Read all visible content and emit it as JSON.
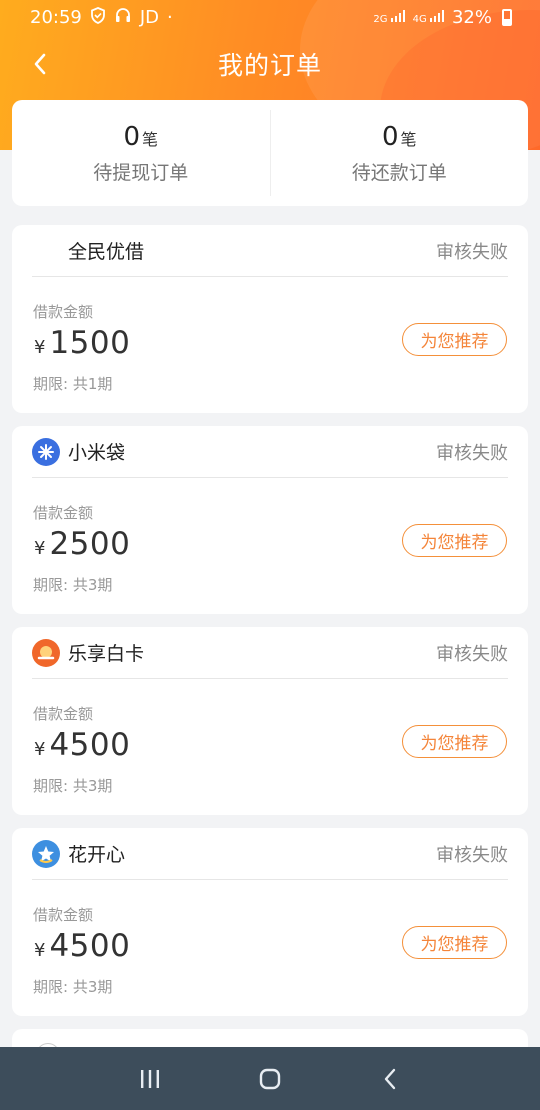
{
  "status_bar": {
    "time": "20:59",
    "carrier": "JD",
    "dot": "·",
    "net1_top": "2G",
    "net2_top": "4G",
    "battery": "32%"
  },
  "header": {
    "title": "我的订单",
    "back_icon": "chevron-left-icon"
  },
  "summary": {
    "withdraw": {
      "count": "0",
      "unit": "笔",
      "label": "待提现订单"
    },
    "repay": {
      "count": "0",
      "unit": "笔",
      "label": "待还款订单"
    }
  },
  "orders": [
    {
      "brand": "全民优借",
      "icon": "none",
      "status": "审核失败",
      "amount_label": "借款金额",
      "currency": "¥",
      "amount": "1500",
      "period": "期限: 共1期",
      "button": "为您推荐"
    },
    {
      "brand": "小米袋",
      "icon": "xiaomidai-logo-icon",
      "icon_color": "#3a6fe0",
      "status": "审核失败",
      "amount_label": "借款金额",
      "currency": "¥",
      "amount": "2500",
      "period": "期限: 共3期",
      "button": "为您推荐"
    },
    {
      "brand": "乐享白卡",
      "icon": "lexiang-logo-icon",
      "icon_color": "#f0672a",
      "status": "审核失败",
      "amount_label": "借款金额",
      "currency": "¥",
      "amount": "4500",
      "period": "期限: 共3期",
      "button": "为您推荐"
    },
    {
      "brand": "花开心",
      "icon": "huakaixin-logo-icon",
      "icon_color": "#3d8fe0",
      "status": "审核失败",
      "amount_label": "借款金额",
      "currency": "¥",
      "amount": "4500",
      "period": "期限: 共3期",
      "button": "为您推荐"
    }
  ],
  "colors": {
    "header_gradient_start": "#ffac1e",
    "header_gradient_end": "#ff6e2a",
    "accent": "#f4853a",
    "nav_bar": "#3d4d5b"
  },
  "nav": {
    "recent": "recent-apps-icon",
    "home": "home-icon",
    "back": "back-icon"
  }
}
